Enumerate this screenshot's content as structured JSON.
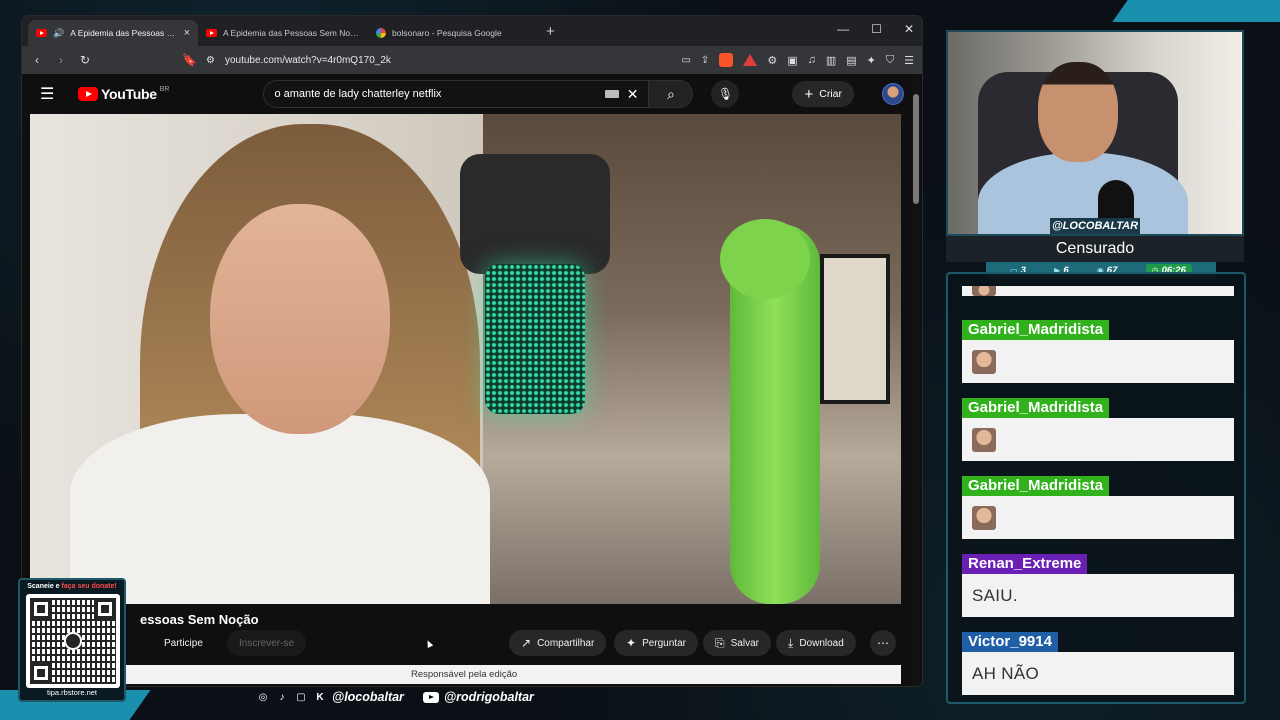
{
  "browser": {
    "tabs": [
      {
        "title": "A Epidemia das Pessoas Sem Noção",
        "active": true,
        "favicon": "youtube-icon",
        "audio": true
      },
      {
        "title": "A Epidemia das Pessoas Sem Noção - YouTube",
        "active": false,
        "favicon": "youtube-icon"
      },
      {
        "title": "bolsonaro - Pesquisa Google",
        "active": false,
        "favicon": "google-icon"
      }
    ],
    "url": "youtube.com/watch?v=4r0mQ170_2k"
  },
  "youtube": {
    "logo_text": "YouTube",
    "region": "BR",
    "search_query": "o amante de lady chatterley netflix",
    "create_label": "Criar",
    "video_title": "essoas Sem Noção",
    "actions": {
      "participe": "Participe",
      "inscrever": "Inscrever-se",
      "compartilhar": "Compartilhar",
      "perguntar": "Perguntar",
      "salvar": "Salvar",
      "download": "Download"
    },
    "edit_banner": "Responsável pela edição"
  },
  "stream": {
    "handle": "@LOCOBALTAR",
    "title": "Censurado",
    "stats": {
      "chat": "3",
      "videos": "6",
      "viewers": "67",
      "time": "06:26"
    }
  },
  "chat": {
    "messages": [
      {
        "user": "Gabriel_Madridista",
        "text": "",
        "emote": true,
        "color": "#31b21d"
      },
      {
        "user": "Gabriel_Madridista",
        "text": "",
        "emote": true,
        "color": "#31b21d"
      },
      {
        "user": "Gabriel_Madridista",
        "text": "",
        "emote": true,
        "color": "#31b21d"
      },
      {
        "user": "Renan_Extreme",
        "text": "SAIU.",
        "emote": false,
        "color": "#6a1fb4"
      },
      {
        "user": "Victor_9914",
        "text": "AH NÃO",
        "emote": false,
        "color": "#1f5fa8"
      }
    ]
  },
  "overlay": {
    "qr_top_a": "Scaneie e ",
    "qr_top_b": "faça seu donate!",
    "qr_bottom": "tipa.rbstore.net",
    "social_1": "@locobaltar",
    "social_2": "@rodrigobaltar"
  },
  "colors": {
    "accent": "#1ea7c9",
    "youtube_red": "#ff0000",
    "chat_green": "#31b21d",
    "chat_purple": "#6a1fb4",
    "chat_blue": "#1f5fa8"
  }
}
